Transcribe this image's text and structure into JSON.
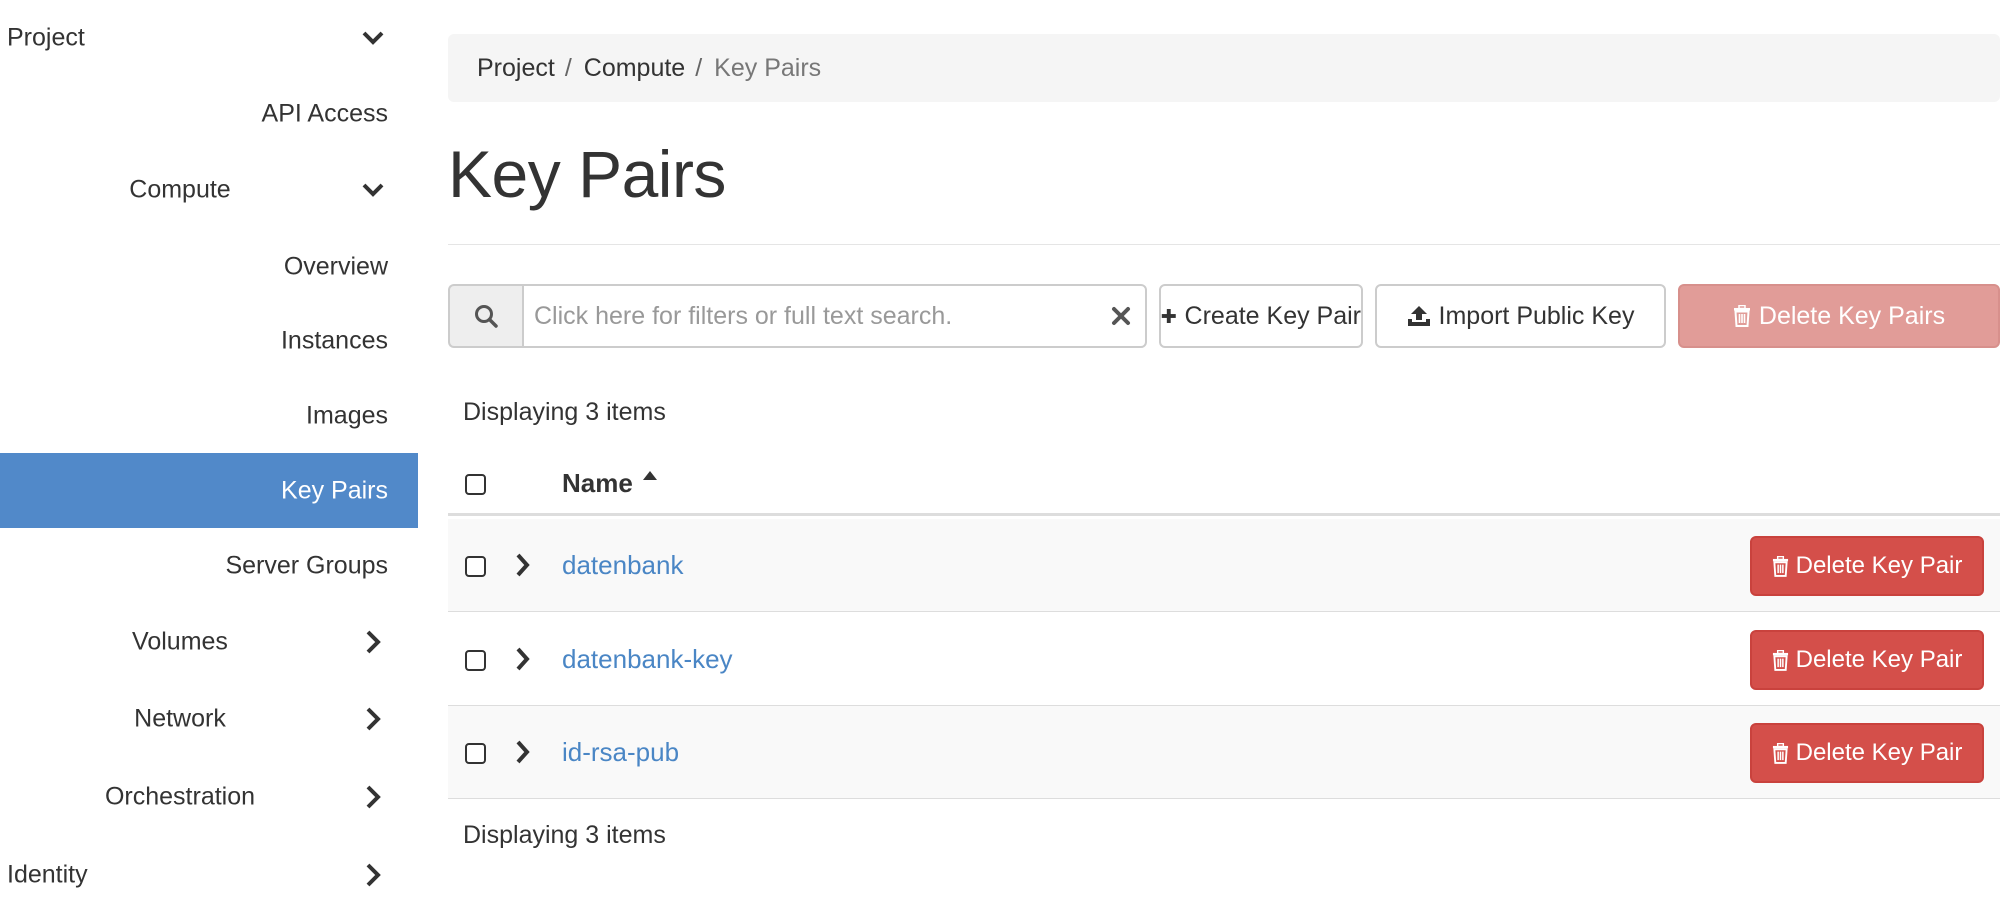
{
  "sidebar": {
    "project": "Project",
    "api_access": "API Access",
    "compute": "Compute",
    "overview": "Overview",
    "instances": "Instances",
    "images": "Images",
    "key_pairs": "Key Pairs",
    "server_groups": "Server Groups",
    "volumes": "Volumes",
    "network": "Network",
    "orchestration": "Orchestration",
    "identity": "Identity",
    "active_item": "Key Pairs",
    "active_color": "#5189c9"
  },
  "breadcrumb": {
    "items": [
      "Project",
      "Compute",
      "Key Pairs"
    ],
    "separator": "/"
  },
  "page_title": "Key Pairs",
  "toolbar": {
    "search_placeholder": "Click here for filters or full text search.",
    "create_label": "Create Key Pair",
    "import_label": "Import Public Key",
    "delete_all_label": "Delete Key Pairs"
  },
  "table": {
    "count_top": "Displaying 3 items",
    "count_bottom": "Displaying 3 items",
    "column_name": "Name",
    "sort": "ascending",
    "rows": [
      {
        "name": "datenbank",
        "action": "Delete Key Pair"
      },
      {
        "name": "datenbank-key",
        "action": "Delete Key Pair"
      },
      {
        "name": "id-rsa-pub",
        "action": "Delete Key Pair"
      }
    ]
  },
  "colors": {
    "link": "#4a86c5",
    "danger": "#d44f4a",
    "danger_disabled": "#e19c98"
  },
  "icons": [
    "chevron-down-icon",
    "chevron-right-icon",
    "search-icon",
    "clear-icon",
    "plus-icon",
    "upload-icon",
    "trash-icon",
    "sort-up-icon"
  ]
}
